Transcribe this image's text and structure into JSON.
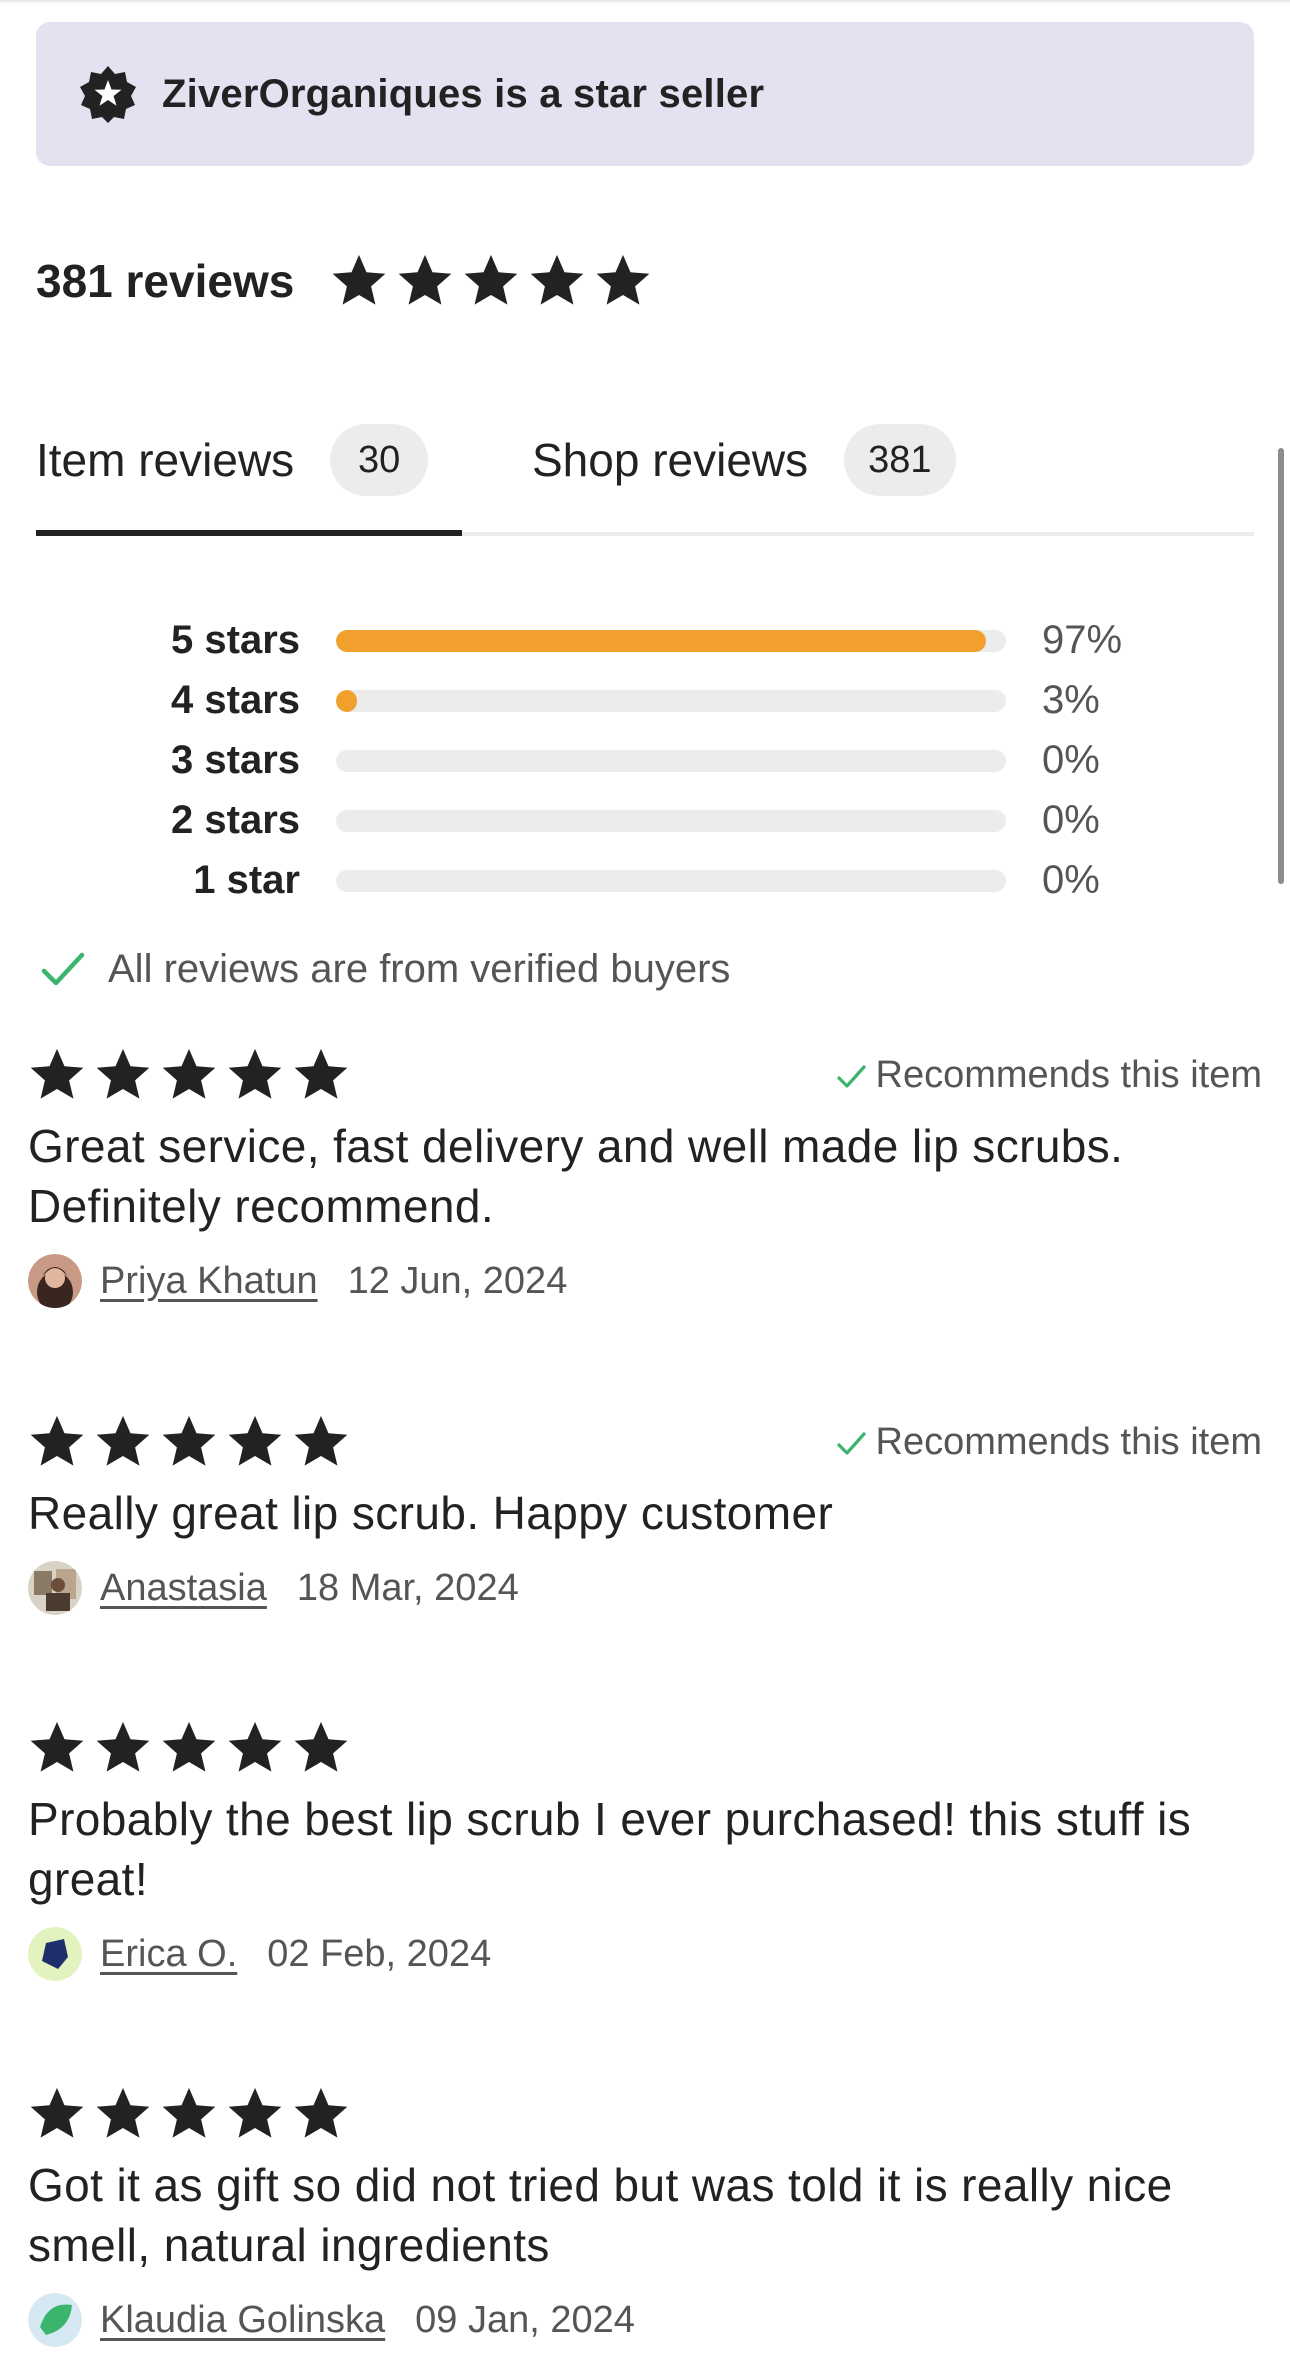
{
  "banner": {
    "text": "ZiverOrganiques is a star seller",
    "icon": "star-badge-icon"
  },
  "summary": {
    "count_label": "381 reviews",
    "rating": 5
  },
  "tabs": [
    {
      "label": "Item reviews",
      "count": "30",
      "active": true
    },
    {
      "label": "Shop reviews",
      "count": "381",
      "active": false
    }
  ],
  "histogram": [
    {
      "label": "5 stars",
      "percent_label": "97%",
      "fill": 0.97
    },
    {
      "label": "4 stars",
      "percent_label": "3%",
      "fill": 0.03
    },
    {
      "label": "3 stars",
      "percent_label": "0%",
      "fill": 0
    },
    {
      "label": "2 stars",
      "percent_label": "0%",
      "fill": 0
    },
    {
      "label": "1 star",
      "percent_label": "0%",
      "fill": 0
    }
  ],
  "verified": {
    "text": "All reviews are from verified buyers",
    "icon": "checkmark-icon"
  },
  "reviews": [
    {
      "rating": 5,
      "recommends": "Recommends this item",
      "text": "Great service, fast delivery and well made lip scrubs. Definitely recommend.",
      "name": "Priya Khatun",
      "date": "12 Jun, 2024"
    },
    {
      "rating": 5,
      "recommends": "Recommends this item",
      "text": "Really great lip scrub. Happy customer",
      "name": "Anastasia",
      "date": "18 Mar, 2024"
    },
    {
      "rating": 5,
      "recommends": "",
      "text": "Probably the best lip scrub I ever purchased! this stuff is great!",
      "name": "Erica O.",
      "date": "02 Feb, 2024"
    },
    {
      "rating": 5,
      "recommends": "",
      "text": "Got it as gift so did not tried but was told it is really nice smell, natural ingredients",
      "name": "Klaudia Golinska",
      "date": "09 Jan, 2024"
    }
  ],
  "colors": {
    "banner_bg": "#e4e1f1",
    "bar_fill": "#f1a02e",
    "bar_track": "#ececec",
    "check_green": "#3bb46e",
    "star": "#222222"
  }
}
